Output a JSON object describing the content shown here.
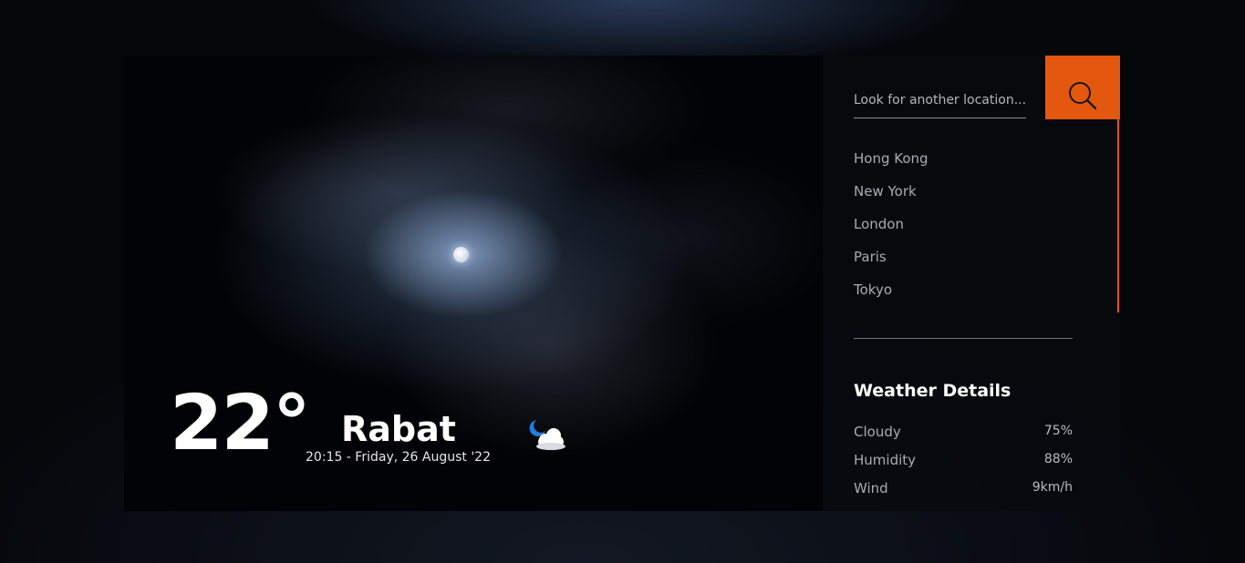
{
  "search": {
    "placeholder": "Look for another location...",
    "button_icon": "search-icon"
  },
  "locations": [
    "Hong Kong",
    "New York",
    "London",
    "Paris",
    "Tokyo"
  ],
  "weather": {
    "temperature": "22°",
    "city": "Rabat",
    "datetime": "20:15 - Friday, 26 August '22",
    "condition_icon": "moon-cloud-icon"
  },
  "details": {
    "title": "Weather Details",
    "rows": [
      {
        "label": "Cloudy",
        "value": "75%"
      },
      {
        "label": "Humidity",
        "value": "88%"
      },
      {
        "label": "Wind",
        "value": "9km/h"
      }
    ]
  },
  "colors": {
    "accent": "#e4570f",
    "background": "#000000",
    "panel": "#08090e"
  }
}
